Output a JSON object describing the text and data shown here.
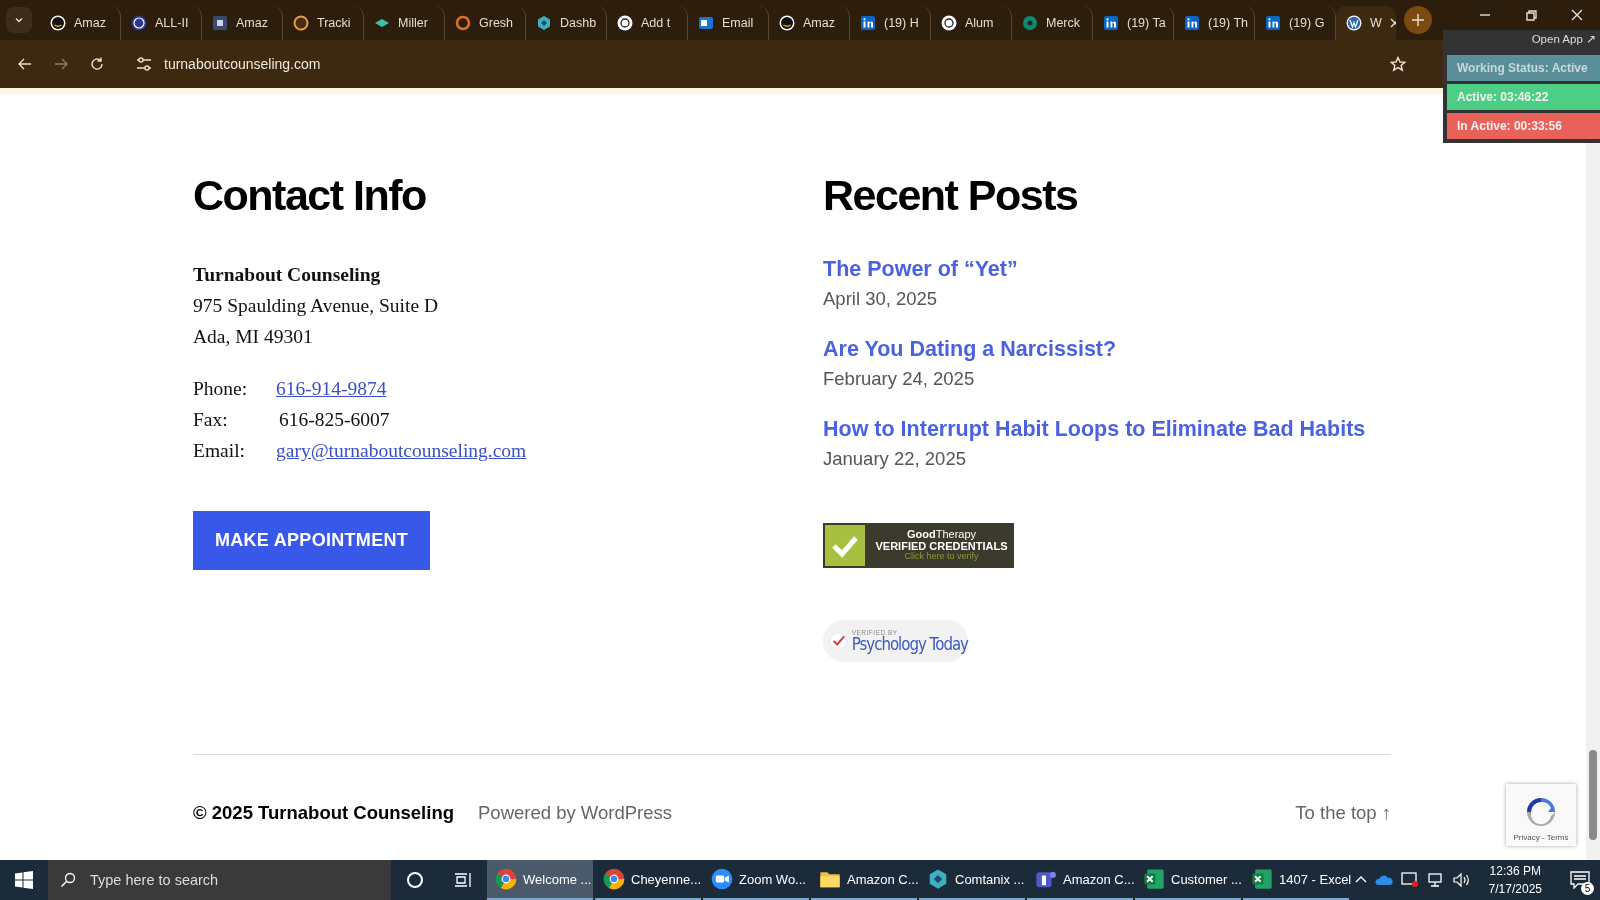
{
  "browser": {
    "tabs": [
      {
        "title": "Amaz",
        "kind": "amazon",
        "selected": false
      },
      {
        "title": "ALL-II",
        "kind": "badge",
        "selected": false
      },
      {
        "title": "Amaz",
        "kind": "square",
        "selected": false
      },
      {
        "title": "Tracki",
        "kind": "shield",
        "selected": false
      },
      {
        "title": "Miller",
        "kind": "diamond",
        "selected": false
      },
      {
        "title": "Gresh",
        "kind": "ring",
        "selected": false
      },
      {
        "title": "Dashb",
        "kind": "hexagon",
        "selected": false
      },
      {
        "title": "Add t",
        "kind": "flower",
        "selected": false
      },
      {
        "title": "Email",
        "kind": "mail",
        "selected": false
      },
      {
        "title": "Amaz",
        "kind": "amazon",
        "selected": false
      },
      {
        "title": "(19) H",
        "kind": "linkedin",
        "selected": false
      },
      {
        "title": "Alum",
        "kind": "flower",
        "selected": false
      },
      {
        "title": "Merck",
        "kind": "cross",
        "selected": false
      },
      {
        "title": "(19) Ta",
        "kind": "linkedin",
        "selected": false
      },
      {
        "title": "(19) Th",
        "kind": "linkedin",
        "selected": false
      },
      {
        "title": "(19) G",
        "kind": "linkedin",
        "selected": false
      },
      {
        "title": "W",
        "kind": "wordpress",
        "selected": true
      }
    ],
    "url": "turnaboutcounseling.com"
  },
  "tracker": {
    "link": "Open App ↗",
    "status": "Working Status: Active",
    "active": "Active: 03:46:22",
    "inactive": "In Active: 00:33:56"
  },
  "contact": {
    "heading": "Contact Info",
    "org": "Turnabout Counseling",
    "address": [
      "975 Spaulding Avenue, Suite D",
      "Ada, MI  49301"
    ],
    "details": [
      {
        "label": "Phone:",
        "value": "616-914-9874",
        "kind": "link"
      },
      {
        "label": "Fax:",
        "value": "616-825-6007",
        "kind": "text"
      },
      {
        "label": "Email:",
        "value": "gary@turnaboutcounseling.com",
        "kind": "link"
      }
    ],
    "button": "MAKE APPOINTMENT"
  },
  "posts": {
    "heading": "Recent Posts",
    "items": [
      {
        "title": "The Power of “Yet”",
        "date": "April 30, 2025"
      },
      {
        "title": "Are You Dating a Narcissist?",
        "date": "February 24, 2025"
      },
      {
        "title": "How to Interrupt Habit Loops to Eliminate Bad Habits",
        "date": "January 22, 2025"
      }
    ]
  },
  "badges": {
    "goodtherapy": {
      "brand": "**Good**Therapy",
      "title": "VERIFIED CREDENTIALS",
      "hint": "Click here to verify"
    },
    "psychology_today": {
      "over": "VERIFIED BY",
      "name": "Psychology Today"
    }
  },
  "footer": {
    "copyright": "© 2025 Turnabout Counseling",
    "powered": "Powered by WordPress",
    "top": "To the top ↑"
  },
  "recaptcha": {
    "links": "Privacy - Terms"
  },
  "taskbar": {
    "search": {
      "placeholder": "Type here to search"
    },
    "apps": [
      {
        "title": "Welcome ...",
        "kind": "chrome",
        "selected": true
      },
      {
        "title": "Cheyenne...",
        "kind": "chrome",
        "selected": false
      },
      {
        "title": "Zoom Wo...",
        "kind": "zoom",
        "selected": false
      },
      {
        "title": "Amazon C...",
        "kind": "folder",
        "selected": false
      },
      {
        "title": "Comtanix ...",
        "kind": "hexagon",
        "selected": false
      },
      {
        "title": "Amazon C...",
        "kind": "teams",
        "selected": false
      },
      {
        "title": "Customer ...",
        "kind": "sheet",
        "selected": false
      },
      {
        "title": "1407 - Excel",
        "kind": "sheet",
        "selected": false
      }
    ],
    "time": "12:36 PM",
    "date": "7/17/2025",
    "notifications": "5"
  }
}
